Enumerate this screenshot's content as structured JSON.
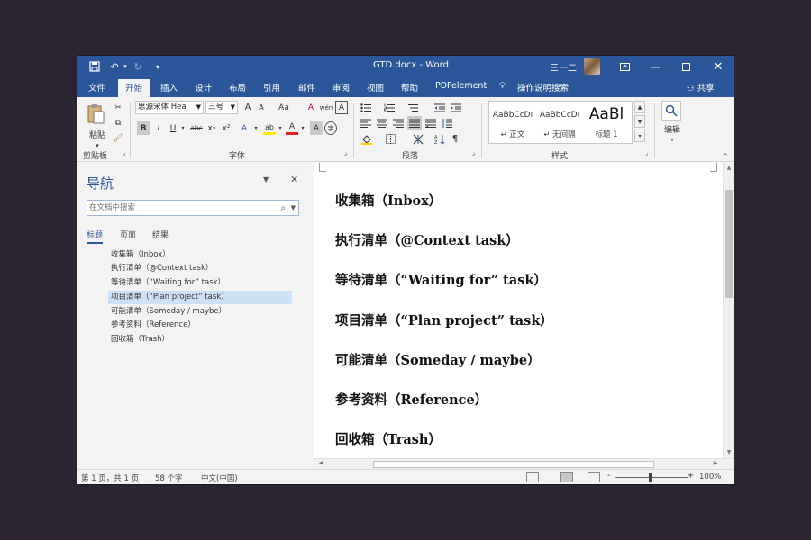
{
  "title_bar": {
    "title": "GTD.docx - Word",
    "user": "三一二",
    "qat": {
      "save_icon": "save-icon",
      "undo_icon": "undo-icon",
      "redo_icon": "redo-icon",
      "customize_icon": "customize-icon"
    },
    "window_icons": {
      "ribbon_display": "ribbon-display-icon",
      "minimize": "minimize-icon",
      "maximize": "maximize-icon",
      "close": "close-icon"
    }
  },
  "menu_tabs": [
    "文件",
    "开始",
    "插入",
    "设计",
    "布局",
    "引用",
    "邮件",
    "审阅",
    "视图",
    "帮助",
    "PDFelement"
  ],
  "menu_active": "开始",
  "tell_me": "操作说明搜索",
  "share": "共享",
  "ribbon": {
    "clipboard": {
      "paste_label": "粘贴",
      "group_label": "剪贴板"
    },
    "font": {
      "font_name": "思源宋体 Hea",
      "font_size": "三号",
      "grow": "A",
      "shrink": "A",
      "change_case": "Aa",
      "clear_format": "A",
      "phonetic": "wén",
      "char_border": "A",
      "bold": "B",
      "italic": "I",
      "underline": "U",
      "strike": "abc",
      "subscript": "x₂",
      "superscript": "x²",
      "text_effects": "A",
      "highlight": "ab",
      "font_color": "A",
      "char_shading": "A",
      "enclose": "字",
      "group_label": "字体"
    },
    "paragraph": {
      "group_label": "段落"
    },
    "styles": {
      "items": [
        {
          "sample": "AaBbCcDı",
          "name": "正文"
        },
        {
          "sample": "AaBbCcDı",
          "name": "无间隔"
        },
        {
          "sample": "AaBl",
          "name": "标题 1"
        }
      ],
      "group_label": "样式"
    },
    "editing": {
      "label": "编辑"
    }
  },
  "nav_pane": {
    "title": "导航",
    "search_placeholder": "在文档中搜索",
    "tabs": [
      "标题",
      "页面",
      "结果"
    ],
    "active_tab": "标题",
    "headings": [
      "收集箱（Inbox）",
      "执行清单（@Context task）",
      "等待清单（“Waiting for” task）",
      "项目清单（“Plan project” task）",
      "可能清单（Someday / maybe）",
      "参考资料（Reference）",
      "回收箱（Trash）"
    ],
    "selected_index": 3
  },
  "document": {
    "lines": [
      "收集箱（Inbox）",
      "执行清单（@Context task）",
      "等待清单（“Waiting for” task）",
      "项目清单（“Plan project” task）",
      "可能清单（Someday / maybe）",
      "参考资料（Reference）",
      "回收箱（Trash）"
    ]
  },
  "status_bar": {
    "page": "第 1 页，共 1 页",
    "words": "58 个字",
    "language": "中文(中国)",
    "zoom_minus": "-",
    "zoom_plus": "+",
    "zoom": "100%",
    "zoom_fraction": 0.5
  },
  "colors": {
    "accent": "#2b579a",
    "background": "#2b2433",
    "nav_selection": "#cde1f6"
  }
}
